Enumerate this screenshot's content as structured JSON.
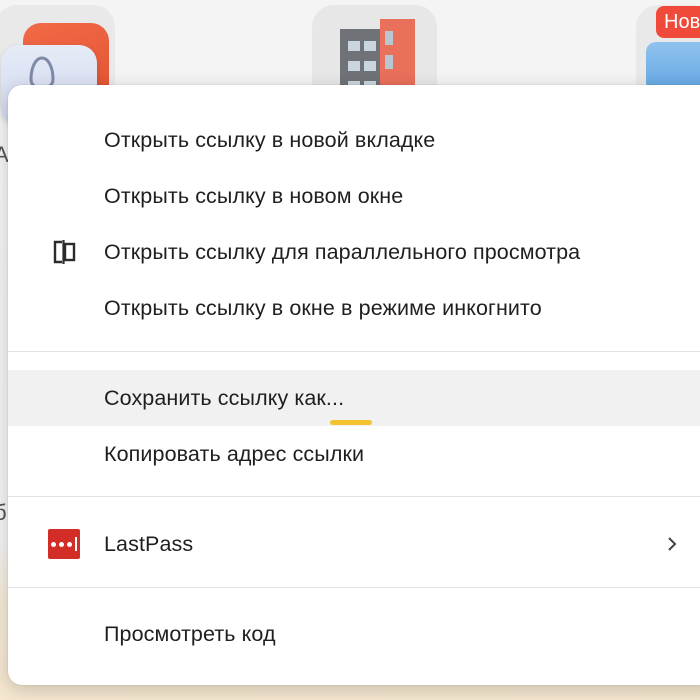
{
  "background": {
    "tiles": [
      {
        "name": "alice-app-tile",
        "icon": "alice-icon"
      },
      {
        "name": "building-tile",
        "icon": "building-icon"
      },
      {
        "name": "news-tile",
        "badge": "Ново"
      }
    ],
    "left_letters": [
      "A",
      "б"
    ]
  },
  "menu": {
    "items": [
      {
        "label": "Открыть ссылку в новой вкладке"
      },
      {
        "label": "Открыть ссылку в новом окне"
      },
      {
        "label": "Открыть ссылку для параллельного просмотра",
        "icon": "split-view-icon"
      },
      {
        "label": "Открыть ссылку в окне в режиме инкогнито"
      },
      {
        "label": "Сохранить ссылку как...",
        "state": "hovered"
      },
      {
        "label": "Копировать адрес ссылки"
      },
      {
        "label": "LastPass",
        "icon": "lastpass-icon",
        "has_submenu": true
      },
      {
        "label": "Просмотреть код"
      }
    ]
  },
  "colors": {
    "menu_bg": "#ffffff",
    "hover_bg": "#f1f1f1",
    "separator": "#e3e3e3",
    "lastpass_red": "#d32d27",
    "cursor_highlight": "#f4c22c"
  }
}
